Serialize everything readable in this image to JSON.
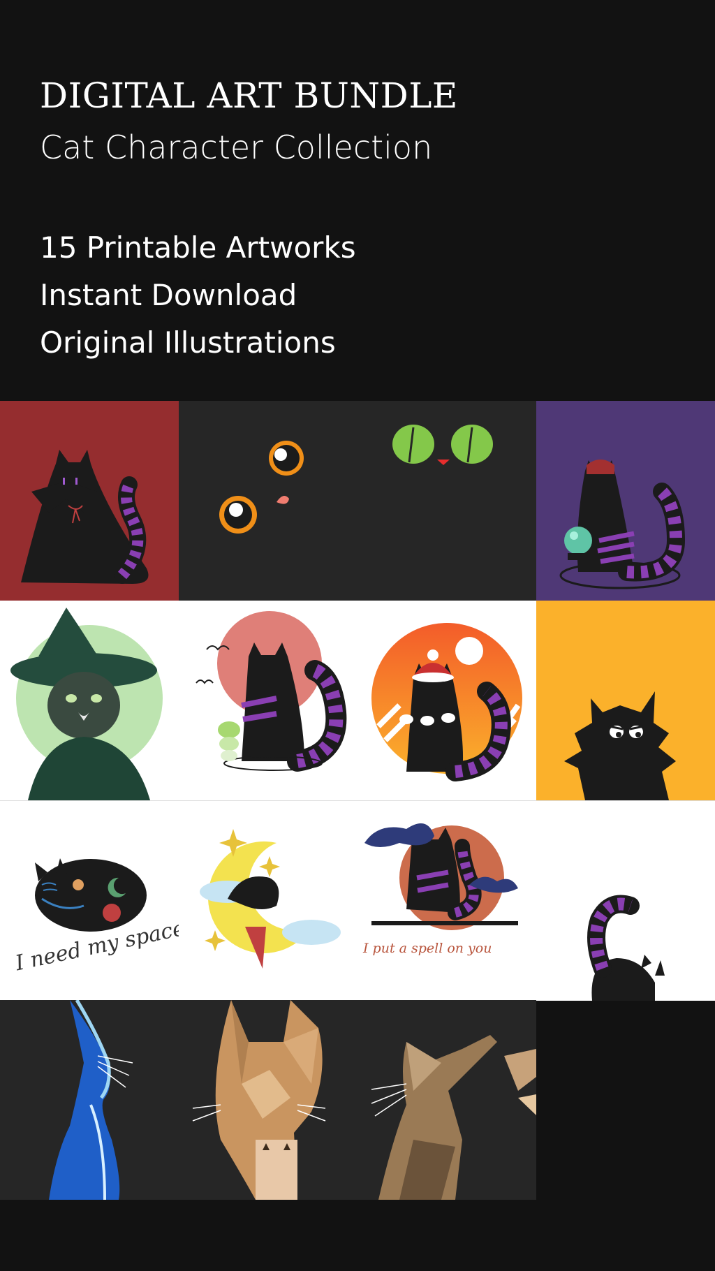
{
  "header": {
    "title": "DIGITAL ART BUNDLE",
    "subtitle": "Cat Character Collection",
    "features": [
      "15 Printable Artworks",
      "Instant Download",
      "Original Illustrations"
    ]
  },
  "artworks": {
    "need_space_text": "I need my space",
    "spell_text": "I put a spell on you"
  },
  "colors": {
    "background": "#121212",
    "red_tile": "#952d2f",
    "dark_tile": "#262626",
    "purple_tile": "#4f3876",
    "yellow_tile": "#fbb12b",
    "accent_purple": "#8a3fb3"
  }
}
